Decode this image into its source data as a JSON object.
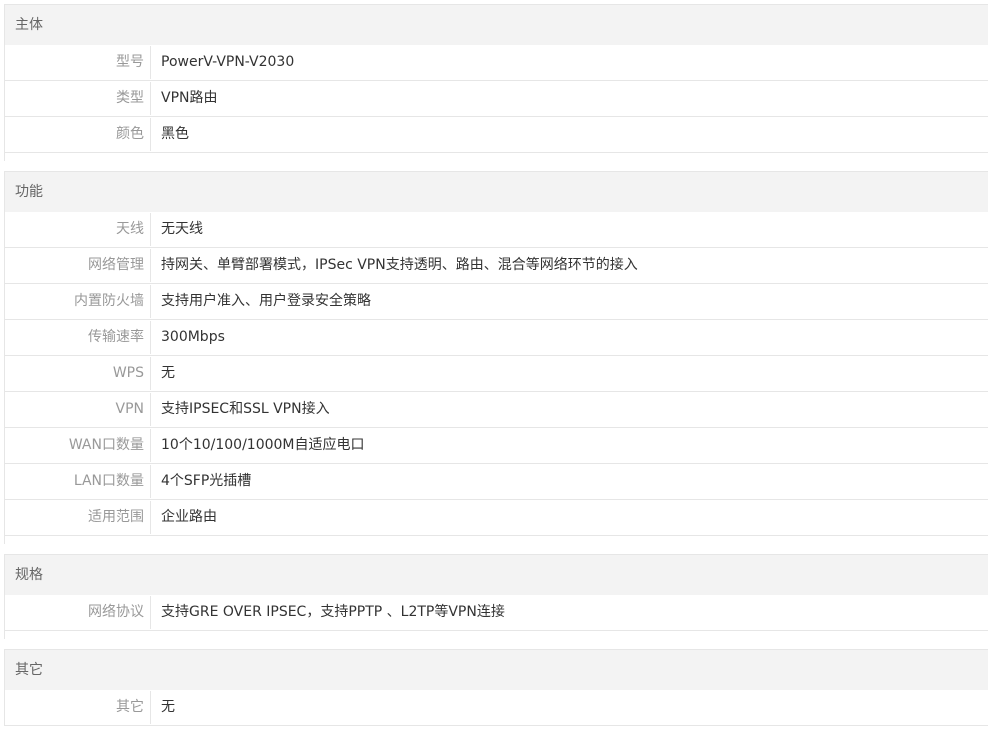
{
  "groups": [
    {
      "title": "主体",
      "rows": [
        {
          "label": "型号",
          "value": "PowerV-VPN-V2030"
        },
        {
          "label": "类型",
          "value": "VPN路由"
        },
        {
          "label": "颜色",
          "value": "黑色"
        }
      ]
    },
    {
      "title": "功能",
      "rows": [
        {
          "label": "天线",
          "value": "无天线"
        },
        {
          "label": "网络管理",
          "value": "持网关、单臂部署模式，IPSec VPN支持透明、路由、混合等网络环节的接入"
        },
        {
          "label": "内置防火墙",
          "value": "支持用户准入、用户登录安全策略"
        },
        {
          "label": "传输速率",
          "value": "300Mbps"
        },
        {
          "label": "WPS",
          "value": "无"
        },
        {
          "label": "VPN",
          "value": "支持IPSEC和SSL VPN接入"
        },
        {
          "label": "WAN口数量",
          "value": "10个10/100/1000M自适应电口"
        },
        {
          "label": "LAN口数量",
          "value": "4个SFP光插槽"
        },
        {
          "label": "适用范围",
          "value": "企业路由"
        }
      ]
    },
    {
      "title": "规格",
      "rows": [
        {
          "label": "网络协议",
          "value": "支持GRE OVER IPSEC，支持PPTP 、L2TP等VPN连接"
        }
      ]
    },
    {
      "title": "其它",
      "rows": [
        {
          "label": "其它",
          "value": "无"
        }
      ]
    }
  ]
}
